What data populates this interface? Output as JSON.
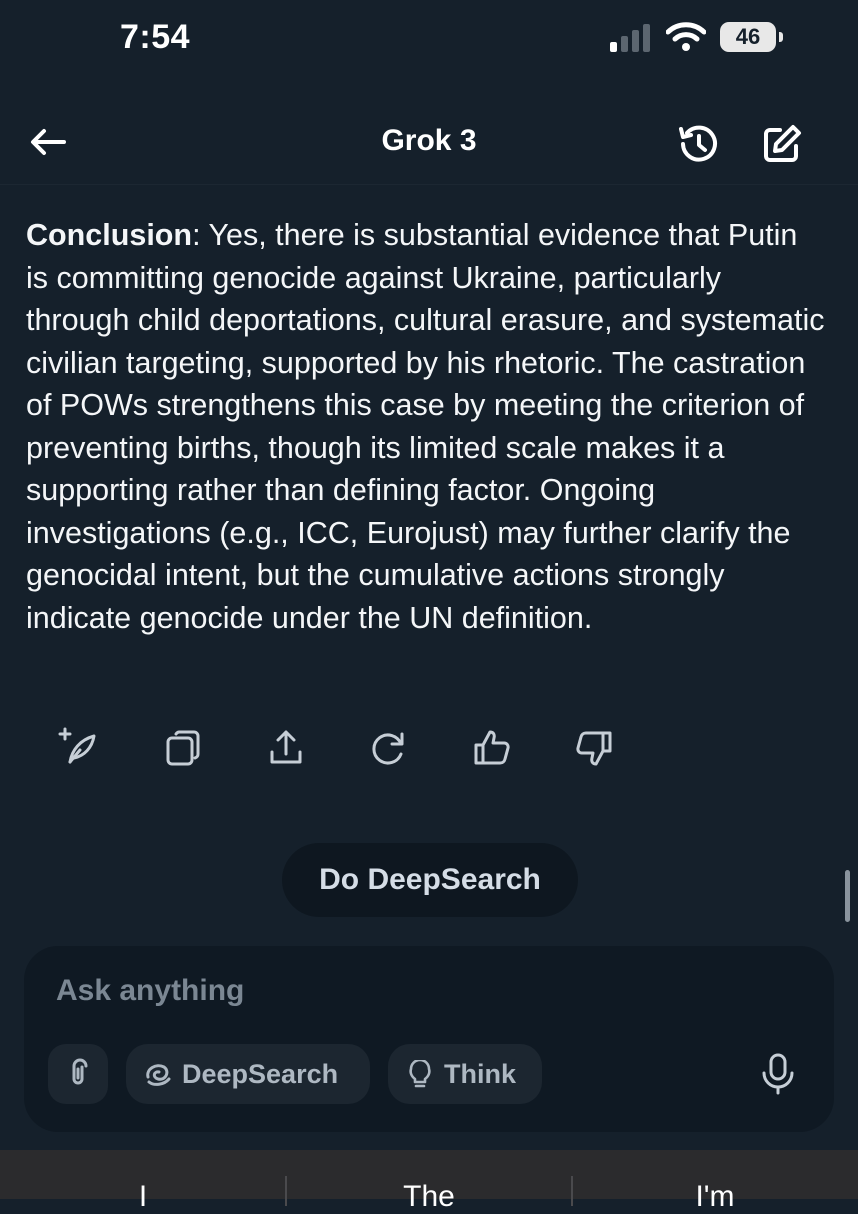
{
  "status_bar": {
    "time": "7:54",
    "battery_level": "46"
  },
  "header": {
    "title": "Grok 3"
  },
  "message": {
    "bold_label": "Conclusion",
    "body": ": Yes, there is substantial evidence that Putin is committing genocide against Ukraine, particularly through child deportations, cultural erasure, and systematic civilian targeting, supported by his rhetoric. The castration of POWs strengthens this case by meeting the criterion of preventing births, though its limited scale makes it a supporting rather than defining factor. Ongoing investigations (e.g., ICC, Eurojust) may further clarify the genocidal intent, but the cumulative actions strongly indicate genocide under the UN definition."
  },
  "actions": [
    "edit-icon",
    "copy-icon",
    "share-icon",
    "regenerate-icon",
    "thumbs-up-icon",
    "thumbs-down-icon"
  ],
  "chip": {
    "label": "Do DeepSearch"
  },
  "composer": {
    "placeholder": "Ask anything",
    "deepsearch_label": "DeepSearch",
    "think_label": "Think"
  },
  "suggestions": [
    "I",
    "The",
    "I'm"
  ],
  "colors": {
    "background": "#15202b",
    "composer": "#0f1923",
    "pill": "#1c2630",
    "keyboard": "#2b2b2d"
  }
}
